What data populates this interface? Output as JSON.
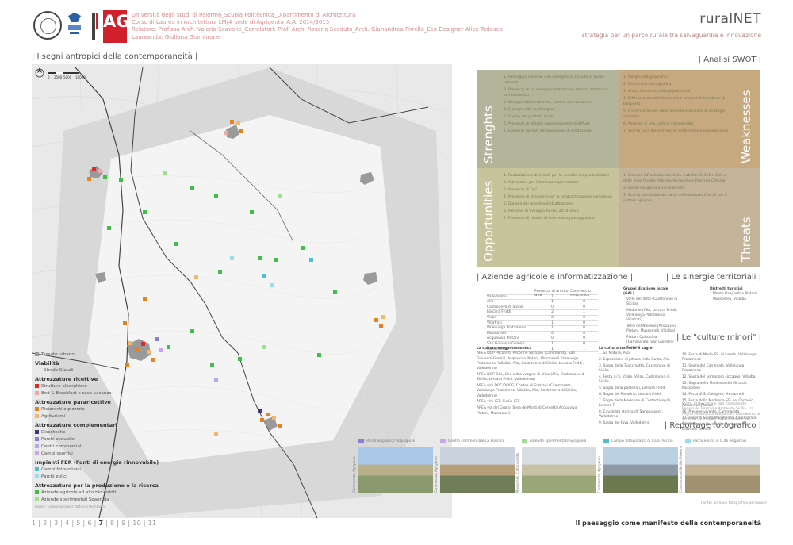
{
  "header": {
    "lines": [
      "Università degli studi di Palermo_Scuola Politecnica_Dipartimento di Architettura",
      "Corso di Laurea in Architettura LM/4_sede di Agrigento_A.A. 2014/2015",
      "Relatore: Prof.ssa Arch. Valeria Scavone_Correlatori: Prof. Arch. Rosario Scaduto_Arch. Gianandrea Pirrello_Eco Designer Alice Todesco",
      "Laureanda: Giuliana Giambrone"
    ],
    "logo_text": "AG",
    "title": "ruralNET",
    "subtitle": "strategia per un parco rurale tra salvaguardia e innovazione"
  },
  "map": {
    "section_title": "| I segni antropici della contemporaneità |",
    "scale_labels": [
      "0",
      "2500",
      "5000",
      "10000"
    ]
  },
  "legend": {
    "items": [
      {
        "kind": "item",
        "label": "Tessuto urbano",
        "color": "#9a9a9a"
      },
      {
        "kind": "head",
        "label": "Viabilità"
      },
      {
        "kind": "item",
        "label": "Strade Statali",
        "color": "#555555",
        "line": true
      },
      {
        "kind": "head",
        "label": "Attrezzature ricettive"
      },
      {
        "kind": "item",
        "label": "Strutture alberghiere",
        "color": "#e02a2a"
      },
      {
        "kind": "item",
        "label": "Bed & Breakfast e case vacanza",
        "color": "#f2a5a5"
      },
      {
        "kind": "head",
        "label": "Attrezzature pararicettive"
      },
      {
        "kind": "item",
        "label": "Ristoranti e pizzerie",
        "color": "#e8821e"
      },
      {
        "kind": "item",
        "label": "Agriturismi",
        "color": "#f5b56a"
      },
      {
        "kind": "head",
        "label": "Attrezzature complementari"
      },
      {
        "kind": "item",
        "label": "Discoteche",
        "color": "#3d3a78"
      },
      {
        "kind": "item",
        "label": "Parchi acquatici",
        "color": "#8d7fd4"
      },
      {
        "kind": "item",
        "label": "Centri commerciali",
        "color": "#b6a8ef"
      },
      {
        "kind": "item",
        "label": "Campi sportivi",
        "color": "#c9a6f0"
      },
      {
        "kind": "head",
        "label": "Impianti FER (Fonti di energia rinnovabile)"
      },
      {
        "kind": "item",
        "label": "Campi fotovoltaici",
        "color": "#4fc0c9"
      },
      {
        "kind": "item",
        "label": "Parchi eolici",
        "color": "#9adff0"
      },
      {
        "kind": "head",
        "label": "Attrezzature per la produzione e la ricerca"
      },
      {
        "kind": "item",
        "label": "Aziende agricole ad alto bio redditi",
        "color": "#3fbf4a"
      },
      {
        "kind": "item",
        "label": "Aziende sperimentali Spagnola",
        "color": "#9fe08f"
      }
    ],
    "note": "Fonte: Elaborazione e dati sul territorio"
  },
  "swot": {
    "section_title": "| Analisi SWOT |",
    "quadrants": [
      {
        "name": "Strenghts",
        "color": "#b3b49a",
        "items": [
          "1. Paesaggio naturale non collegato al circuito di alcuni network",
          "2. Presenza di un variegato patrimonio storico, artistico e architettonico",
          "3. Omogeneità territoriale, sociale ed economica",
          "4. Eterogeneità morfologica",
          "5. Specie dei prodotti locali",
          "6. Presenza di attività agrosilvopastorali diffuse",
          "7. Elementi ripetuti del paesaggio di produzione"
        ]
      },
      {
        "name": "Weaknesses",
        "color": "#c7a97f",
        "items": [
          "1. Marginalità geografica",
          "2. Decrescita demografica",
          "3. Invecchiamento della popolazione",
          "4. Difficile accessibilità dovuta a scarse infrastrutture di trasporto",
          "5. Frammentazione delle aziende e assenza di strategie aziendali",
          "6. Assenza di una cultura manageriale",
          "7. Scarsa cura del patrimonio ambientale e paesaggistico"
        ]
      },
      {
        "name": "Opportunities",
        "color": "#c7c39a",
        "items": [
          "1. Realizzazione di circuiti per la vendita dei prodotti tipici",
          "2. Attenzione per il turismo esperienziale",
          "3. Presenza di GAL",
          "4. Presenza di strumenti per la programmazione complessa",
          "5. Dialogo dei grandi poli di attrazione",
          "6. Politiche di Sviluppo Rurale 2014-2020",
          "7. Presenza di risorse di interesse e paesaggistico"
        ]
      },
      {
        "name": "Threats",
        "color": "#c3b49a",
        "items": [
          "1. Sistema infrastrutturale della viabilità SS 115 e 189 e delle linee ferrate Palermo-Agrigento e Palermo-Catania",
          "2. Esodo dei giovani verso le città",
          "3. Scarsa attenzione da parte delle istituzioni locali per il settore agricolo"
        ]
      }
    ]
  },
  "aziende": {
    "section_title": "| Aziende agricole e informatizzazione |",
    "col_a": "Presenza di un sito web",
    "col_b": "Commercio elettronico",
    "rows": [
      {
        "name": "Valledolmo",
        "a": "1",
        "b": "1"
      },
      {
        "name": "Alia",
        "a": "1",
        "b": "0"
      },
      {
        "name": "Castronovo di Sicilia",
        "a": "0",
        "b": "0"
      },
      {
        "name": "Lercara Friddi",
        "a": "2",
        "b": "1"
      },
      {
        "name": "Vicari",
        "a": "0",
        "b": "0"
      },
      {
        "name": "Villafrati",
        "a": "1",
        "b": "0"
      },
      {
        "name": "Vallelunga Pratameno",
        "a": "1",
        "b": "0"
      },
      {
        "name": "Mussomeli",
        "a": "0",
        "b": "0"
      },
      {
        "name": "Acquaviva Platani",
        "a": "0",
        "b": "0"
      },
      {
        "name": "San Giovanni Gemini",
        "a": "1",
        "b": "0"
      },
      {
        "name": "Cammarata",
        "a": "1",
        "b": "1"
      }
    ]
  },
  "sinergie": {
    "section_title": "| Le sinergie territoriali |",
    "left_head": "Gruppi di azione locale (GAL)",
    "left_items": [
      "Valle del Torto (Castronovo di Sicilia)",
      "Madonie (Alia, Lercara Friddi, Vallelunga Pratameno, Villafrati)",
      "Terre del Nisseno (Acquaviva Platani, Mussomeli, Villalba)",
      "Platani Quisquina (Cammarata, San Giovanni Gemini)"
    ],
    "right_head": "Distretti turistici",
    "right_items": [
      "Monte Uaaj ardua Platani Mussomeli, Villalba"
    ]
  },
  "culture": {
    "section_title": "| Le \"culture minori\" |",
    "enog_head": "La cultura enogastronomica",
    "enog_items": [
      "AREA DOP Pecorino, Pecorino Siciliano (Cammarata, San Giovanni Gemini, Acquaviva Platani, Mussomeli Vallelunga Pratameno, Villalba, Alia, Castronovo di Sicilia, Lercara Friddi, Valledolmo)",
      "AREA DOP Olio, Olio extra vergine di oliva (Alia, Castronovo di Sicilia, Lercara Friddi, Valledolmo)",
      "AREA vini DOC/DOCG, Contea di Sclafani (Cammarata, Vallelunga Pratameno, Villalba, Alia, Castronovo di Sicilia, Valledolmo)",
      "AREA vini IGT, Sicilia IGT",
      "AREA via del Grano, Sesa de Monti di Cornetti (Acquaviva Platani, Mussomeli)"
    ],
    "feste_head": "La cultura tra feste e sagre",
    "feste_items": [
      "1. Sa Matura, Alia",
      "2. Esposizione di pittura nella Gutta, Alia",
      "3. Sagra della Tuocchiatta, Castronovo di Sicilia",
      "4. Festa di S. Vitale, Villas, Castronovo di Sicilia",
      "5. Sagra della pastellan, Lercara Friddi",
      "6. Sagra del Pecorino, Lercara Friddi",
      "7. Sagra della Madonna di Costantinopoli, Lercara F.",
      "8. Cavalcata storica di 'Sangiuvanni', Valledolmo",
      "9. Sagra del fava, Valledolmo"
    ],
    "feste_items2": [
      "10. Festa di Maria SS. di Loreto, Vallelunga Pratameno",
      "11. Sagra del Carnevale, Vallelunga Pratameno",
      "12. Sagra del pomodoro siccagno, Villalba",
      "13. Sagra della Madonna dei Miracoli, Mussomeli",
      "14. Festa di S. Calogero, Mussomeli",
      "15. Festa della Madonna SS. del Carmelo, Acquaviva Platani",
      "16. Presepe vivente, Cammarata",
      "17. Festa di Santa Margherita, Cammarata",
      "18. Festa del Fiore della Montagna, San Giovanni Gemini"
    ],
    "source": "Fonte: Elaborazione dati Assessorato Regionale Turismo e Ambiente Sicilia, tra l'Agritransumanza Mussomeli, Valledolmo, ai sensi LR 11 maggio 2015, L'Unione del Pecorino"
  },
  "reportage": {
    "section_title": "| Reportage fotografico |",
    "captions": [
      {
        "label": "Parco acquatico Acquapark",
        "color": "#8d7fd4"
      },
      {
        "label": "Centro commerciale La Fornace",
        "color": "#c9a6f0"
      },
      {
        "label": "Aziende sperimentale Spagnola",
        "color": "#9fe08f"
      },
      {
        "label": "Campo fotovoltaico di Cala Piscina",
        "color": "#4fc0c9"
      },
      {
        "label": "Parco eolico in C.da Regalmici",
        "color": "#9adff0"
      }
    ],
    "side_labels": [
      "Cammarata, Agrigento",
      "Cammarata, Agrigento",
      "Mussomeli, Caltanissetta",
      "Cammarata, Agrigento",
      "Castronovo di Sicilia, Palermo"
    ],
    "note": "Fonte: archivio fotografico personale"
  },
  "pager": {
    "pages": [
      "1",
      "2",
      "3",
      "4",
      "5",
      "6",
      "7",
      "8",
      "9",
      "10",
      "11"
    ],
    "current": "7"
  },
  "footer": "Il paesaggio come manifesto della contemporaneità"
}
